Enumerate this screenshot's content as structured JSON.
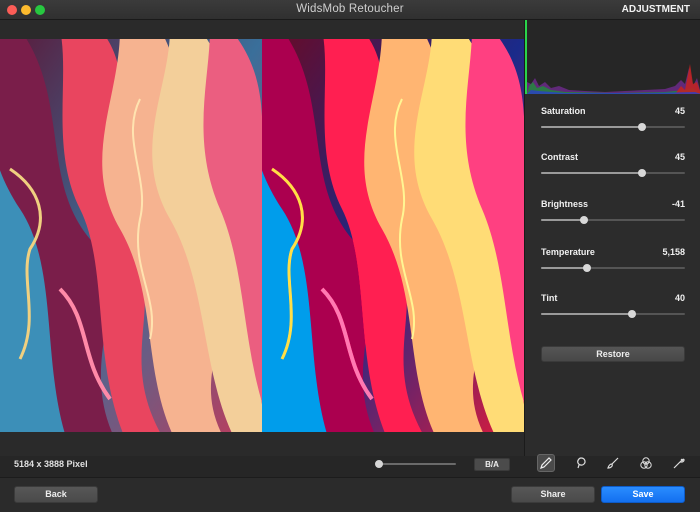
{
  "window": {
    "title": "WidsMob Retoucher",
    "panel_title": "ADJUSTMENT"
  },
  "adjustments": [
    {
      "label": "Saturation",
      "value": "45",
      "level": 0.7
    },
    {
      "label": "Contrast",
      "value": "45",
      "level": 0.7
    },
    {
      "label": "Brightness",
      "value": "-41",
      "level": 0.3
    },
    {
      "label": "Temperature",
      "value": "5,158",
      "level": 0.32
    },
    {
      "label": "Tint",
      "value": "40",
      "level": 0.63
    }
  ],
  "restore_label": "Restore",
  "image_info": "5184 x 3888 Pixel",
  "zoom_level": 0,
  "ba_label": "B/A",
  "tools": [
    "pencil-icon",
    "lasso-icon",
    "brush-icon",
    "color-circles-icon",
    "eyedropper-icon"
  ],
  "active_tool": "pencil-icon",
  "buttons": {
    "back": "Back",
    "share": "Share",
    "save": "Save"
  },
  "colors": {
    "accent": "#1a7cff",
    "background": "#262626"
  }
}
